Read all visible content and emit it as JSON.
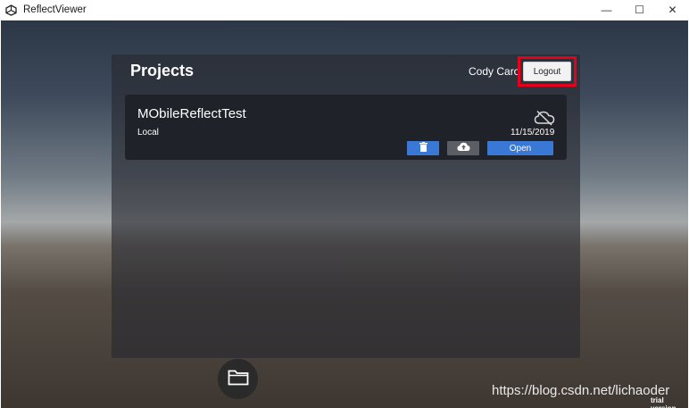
{
  "window": {
    "title": "ReflectViewer",
    "app_icon": "unity-icon",
    "controls": {
      "minimize": "—",
      "maximize": "☐",
      "close": "✕"
    }
  },
  "panel": {
    "title": "Projects",
    "user_name": "Cody Caro",
    "logout_label": "Logout",
    "highlight_color": "#e8001a"
  },
  "project": {
    "name": "MObileReflectTest",
    "location": "Local",
    "date": "11/15/2019",
    "status_icon": "cloud-offline-icon",
    "delete_icon": "trash-icon",
    "upload_icon": "cloud-upload-icon",
    "open_label": "Open"
  },
  "bottom": {
    "folder_icon": "folder-icon"
  },
  "overlay": {
    "watermark": "https://blog.csdn.net/lichaoder",
    "trial": "trial version"
  },
  "colors": {
    "accent": "#3a78d6",
    "card_bg": "#1f2329"
  }
}
